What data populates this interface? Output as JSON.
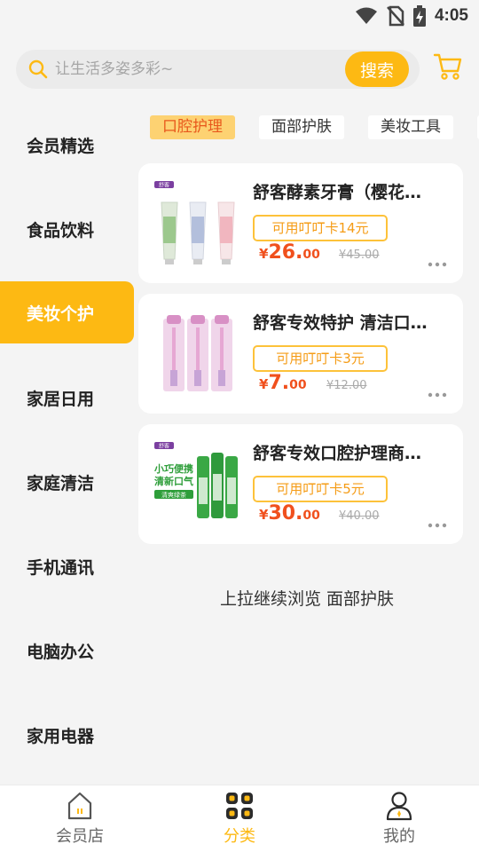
{
  "status_bar": {
    "time": "4:05",
    "icons": [
      "wifi-icon",
      "no-sim-icon",
      "battery-charging-icon"
    ]
  },
  "search": {
    "placeholder": "让生活多姿多彩~",
    "button_label": "搜索",
    "icon": "search-icon"
  },
  "header": {
    "cart_icon": "cart-icon"
  },
  "sidebar": {
    "items": [
      {
        "label": "会员精选",
        "active": false
      },
      {
        "label": "食品饮料",
        "active": false
      },
      {
        "label": "美妆个护",
        "active": true
      },
      {
        "label": "家居日用",
        "active": false
      },
      {
        "label": "家庭清洁",
        "active": false
      },
      {
        "label": "手机通讯",
        "active": false
      },
      {
        "label": "电脑办公",
        "active": false
      },
      {
        "label": "家用电器",
        "active": false
      }
    ]
  },
  "tabs": [
    {
      "label": "口腔护理",
      "active": true
    },
    {
      "label": "面部护肤",
      "active": false
    },
    {
      "label": "美妆工具",
      "active": false
    }
  ],
  "products": [
    {
      "name": "舒客酵素牙膏（樱花…",
      "coupon": "可用叮叮卡14元",
      "price_symbol": "¥",
      "price_int": "26.",
      "price_dec": "00",
      "original_price": "¥45.00",
      "thumb_brand": "舒客",
      "thumb_text": ""
    },
    {
      "name": "舒客专效特护 清洁口…",
      "coupon": "可用叮叮卡3元",
      "price_symbol": "¥",
      "price_int": "7.",
      "price_dec": "00",
      "original_price": "¥12.00",
      "thumb_brand": "",
      "thumb_text": ""
    },
    {
      "name": "舒客专效口腔护理商…",
      "coupon": "可用叮叮卡5元",
      "price_symbol": "¥",
      "price_int": "30.",
      "price_dec": "00",
      "original_price": "¥40.00",
      "thumb_brand": "舒客",
      "thumb_text_1": "小巧便携",
      "thumb_text_2": "清新口气",
      "thumb_badge": "清爽绿茶"
    }
  ],
  "load_more_text": "上拉继续浏览 面部护肤",
  "bottom_nav": [
    {
      "label": "会员店",
      "icon": "home-icon",
      "active": false
    },
    {
      "label": "分类",
      "icon": "category-grid-icon",
      "active": true
    },
    {
      "label": "我的",
      "icon": "user-icon",
      "active": false
    }
  ],
  "colors": {
    "accent": "#fdb913",
    "price": "#f0501d",
    "coupon_text": "#f59c16",
    "tab_active_bg": "#fdd272",
    "tab_active_text": "#e8581c"
  }
}
